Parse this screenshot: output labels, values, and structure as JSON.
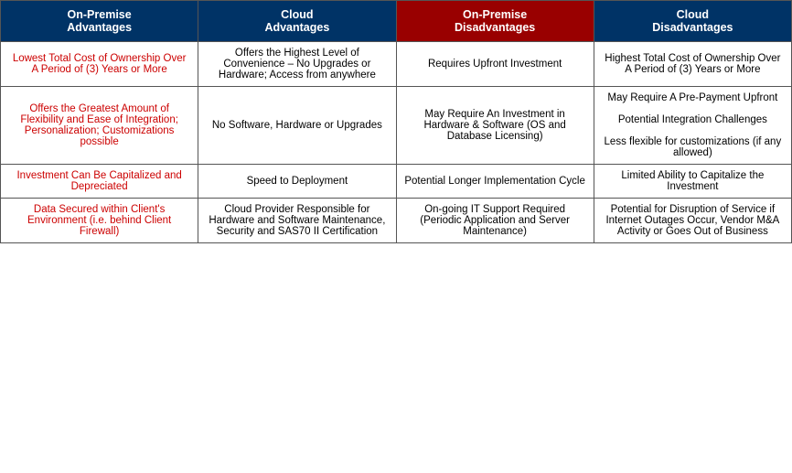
{
  "headers": {
    "col1": "On-Premise\nAdvantages",
    "col2": "Cloud\nAdvantages",
    "col3": "On-Premise\nDisadvantages",
    "col4": "Cloud\nDisadvantages"
  },
  "rows": [
    {
      "col1": "Lowest Total Cost of Ownership Over A Period of (3) Years or More",
      "col2": "Offers the Highest Level of Convenience – No Upgrades or Hardware; Access from anywhere",
      "col3": "Requires Upfront Investment",
      "col4": "Highest Total Cost of Ownership Over A Period of (3) Years or More"
    },
    {
      "col1": "Offers the Greatest Amount of Flexibility and Ease of Integration; Personalization; Customizations possible",
      "col2": "No Software, Hardware or Upgrades",
      "col3": "May Require An Investment in Hardware & Software (OS and Database Licensing)",
      "col4": "May Require A Pre-Payment Upfront\n\nPotential Integration Challenges\n\nLess flexible for customizations (if any allowed)"
    },
    {
      "col1": "Investment Can Be Capitalized and Depreciated",
      "col2": "Speed to Deployment",
      "col3": "Potential Longer Implementation Cycle",
      "col4": "Limited Ability to Capitalize the Investment"
    },
    {
      "col1": "Data Secured within Client's Environment (i.e. behind Client Firewall)",
      "col2": "Cloud Provider Responsible for Hardware and Software Maintenance, Security and SAS70 II Certification",
      "col3": "On-going IT Support Required (Periodic Application and Server Maintenance)",
      "col4": "Potential for Disruption of Service if Internet Outages Occur, Vendor M&A Activity or Goes Out of Business"
    }
  ]
}
